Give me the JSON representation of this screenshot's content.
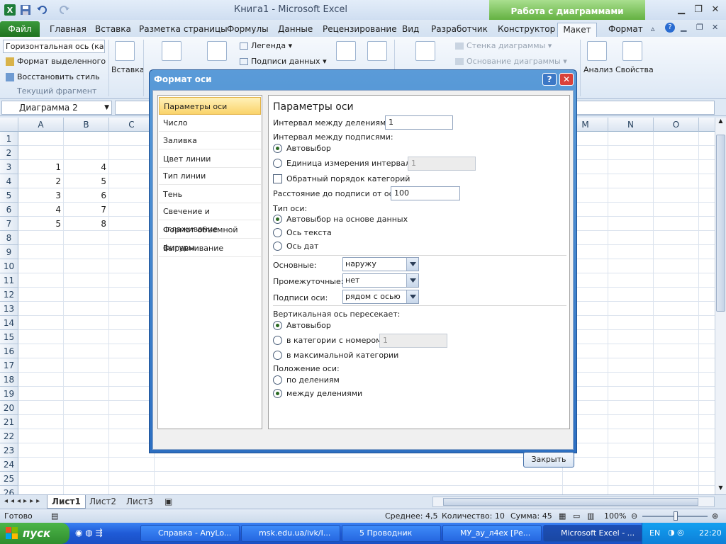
{
  "window": {
    "title": "Книга1 - Microsoft Excel",
    "context_tab_title": "Работа с диаграммами"
  },
  "tabs": [
    {
      "label": "Файл"
    },
    {
      "label": "Главная"
    },
    {
      "label": "Вставка"
    },
    {
      "label": "Разметка страницы"
    },
    {
      "label": "Формулы"
    },
    {
      "label": "Данные"
    },
    {
      "label": "Рецензирование"
    },
    {
      "label": "Вид"
    },
    {
      "label": "Разработчик"
    },
    {
      "label": "Конструктор"
    },
    {
      "label": "Макет"
    },
    {
      "label": "Формат"
    }
  ],
  "ribbon": {
    "selection_combo": "Горизонтальная ось (ка",
    "format_selection": "Формат выделенного",
    "reset_style": "Восстановить стиль",
    "group_current": "Текущий фрагмент",
    "insert": "Вставка",
    "legend": "Легенда",
    "data_labels": "Подписи данных",
    "chart_wall": "Стенка диаграммы",
    "chart_floor": "Основание диаграммы",
    "analysis": "Анализ",
    "properties": "Свойства"
  },
  "formula_bar": {
    "name_box": "Диаграмма 2"
  },
  "grid": {
    "columns": [
      "A",
      "B",
      "C",
      "M",
      "N",
      "O"
    ],
    "rows": [
      "1",
      "2",
      "3",
      "4",
      "5",
      "6",
      "7",
      "8",
      "9",
      "10",
      "11",
      "12",
      "13",
      "14",
      "15",
      "16",
      "17",
      "18",
      "19",
      "20",
      "21",
      "22",
      "23",
      "24",
      "25",
      "26"
    ],
    "col_a": [
      "",
      "",
      "1",
      "2",
      "3",
      "4",
      "5"
    ],
    "col_b": [
      "",
      "",
      "4",
      "5",
      "6",
      "7",
      "8"
    ]
  },
  "sheets": [
    "Лист1",
    "Лист2",
    "Лист3"
  ],
  "status": {
    "ready": "Готово",
    "average": "Среднее: 4,5",
    "count": "Количество: 10",
    "sum": "Сумма: 45",
    "zoom": "100%"
  },
  "dialog": {
    "title": "Формат оси",
    "categories": [
      "Параметры оси",
      "Число",
      "Заливка",
      "Цвет линии",
      "Тип линии",
      "Тень",
      "Свечение и сглаживание",
      "Формат объемной фигуры",
      "Выравнивание"
    ],
    "heading": "Параметры оси",
    "tick_interval_label": "Интервал между делениями:",
    "tick_interval_value": "1",
    "label_interval_label": "Интервал между подписями:",
    "label_auto": "Автовыбор",
    "label_unit": "Единица измерения интервала:",
    "label_unit_value": "1",
    "reverse_order": "Обратный порядок категорий",
    "label_distance_label": "Расстояние до подписи от оси:",
    "label_distance_value": "100",
    "axis_type_label": "Тип оси:",
    "axis_type_auto": "Автовыбор на основе данных",
    "axis_type_text": "Ось текста",
    "axis_type_date": "Ось дат",
    "major_label": "Основные:",
    "major_value": "наружу",
    "minor_label": "Промежуточные:",
    "minor_value": "нет",
    "axis_labels_label": "Подписи оси:",
    "axis_labels_value": "рядом с осью",
    "cross_label": "Вертикальная ось пересекает:",
    "cross_auto": "Автовыбор",
    "cross_category": "в категории с номером:",
    "cross_category_value": "1",
    "cross_max": "в максимальной категории",
    "position_label": "Положение оси:",
    "position_on": "по делениям",
    "position_between": "между делениями",
    "close": "Закрыть"
  },
  "taskbar": {
    "start": "пуск",
    "items": [
      "Справка - AnyLo...",
      "msk.edu.ua/ivk/I...",
      "5 Проводник",
      "МУ_ау_л4ex [Ре...",
      "Microsoft Excel - ..."
    ],
    "lang": "EN",
    "time": "22:20"
  }
}
